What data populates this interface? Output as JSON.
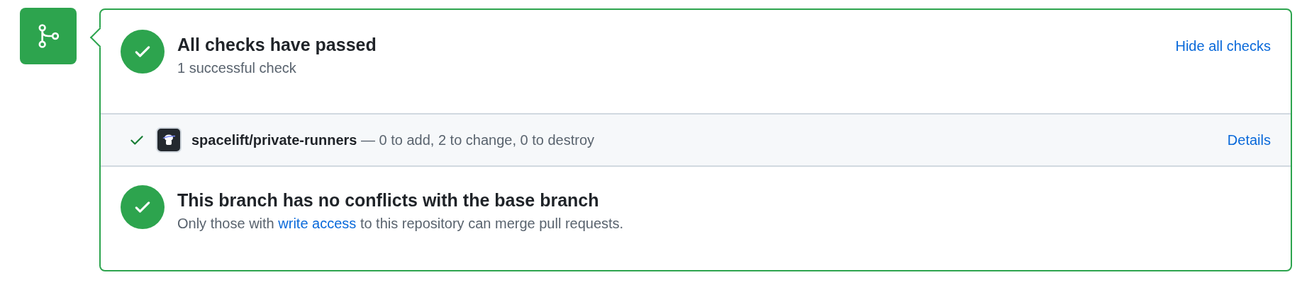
{
  "checks_summary": {
    "title": "All checks have passed",
    "subtitle": "1 successful check",
    "toggle_link": "Hide all checks"
  },
  "checks": [
    {
      "kind": "success",
      "text": "**spacelift/private-runners** — 0 to add, 2 to change, 0 to destroy",
      "link": "Details"
    }
  ],
  "merge_status": {
    "title": "This branch has no conflicts with the base branch",
    "text_before": "Only those with ",
    "link": "write access",
    "text_after": " to this repository can merge pull requests."
  }
}
